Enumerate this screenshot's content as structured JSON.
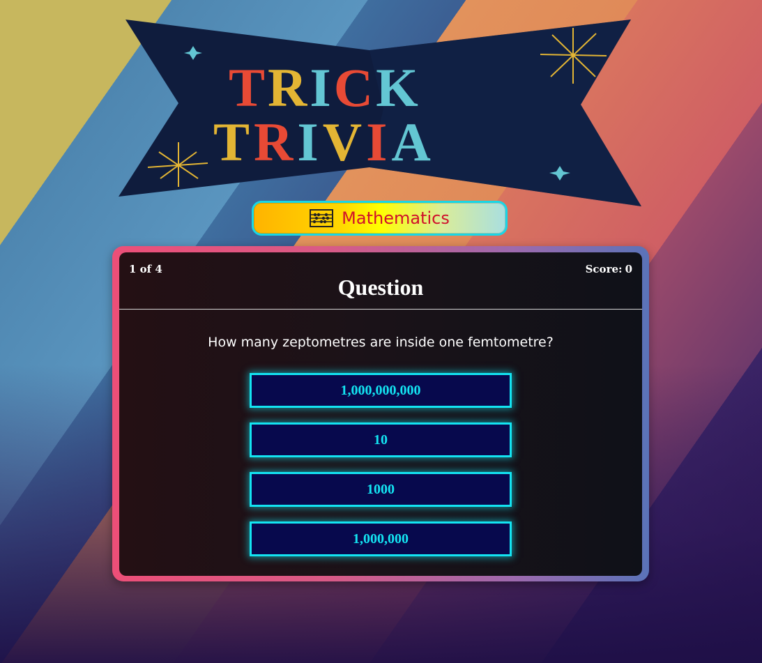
{
  "logo": {
    "line1": "TRICK",
    "line2": "TRIVIA",
    "colors": {
      "banner": "#0f1c3d",
      "red": "#e84a35",
      "yellow": "#e3b534",
      "teal": "#63c6d3",
      "star": "#e3b534"
    }
  },
  "category": {
    "icon": "abacus-icon",
    "label": "Mathematics"
  },
  "quiz": {
    "counter": "1 of 4",
    "score_label": "Score:",
    "score_value": "0",
    "heading": "Question",
    "question": "How many zeptometres are inside one femtometre?",
    "answers": [
      {
        "label": "1,000,000,000"
      },
      {
        "label": "10"
      },
      {
        "label": "1000"
      },
      {
        "label": "1,000,000"
      }
    ]
  }
}
